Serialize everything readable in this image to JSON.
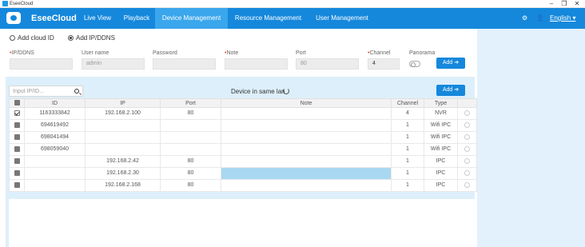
{
  "window": {
    "title": "EseeCloud",
    "minimize": "–",
    "maximize": "❐",
    "close": "✕"
  },
  "nav": {
    "logo": "EseeCloud",
    "items": [
      "Live View",
      "Playback",
      "Device Management",
      "Resource Management",
      "User Management"
    ],
    "active": "Device Management",
    "language": "English ▾"
  },
  "add_mode": {
    "cloud_id_label": "Add cloud ID",
    "ip_ddns_label": "Add IP/DDNS",
    "selected": "Add IP/DDNS"
  },
  "form": {
    "ip_ddns_label": "IP/DDNS",
    "username_label": "User name",
    "username_value": "admin",
    "password_label": "Password",
    "note_label": "Note",
    "port_label": "Port",
    "port_value": "80",
    "channel_label": "Channel",
    "channel_value": "4",
    "panorama_label": "Panorama",
    "add_button": "Add ➔",
    "required_mark": "•"
  },
  "lan": {
    "search_placeholder": "Input IP/ID...",
    "title": "Device in same lan",
    "add_button": "Add ➔"
  },
  "table": {
    "columns": [
      "ID",
      "IP",
      "Port",
      "Note",
      "Channel",
      "Type"
    ],
    "rows": [
      {
        "checked": true,
        "id": "1163333842",
        "ip": "192.168.2.100",
        "port": "80",
        "note": "",
        "channel": "4",
        "type": "NVR"
      },
      {
        "checked": false,
        "id": "694619492",
        "ip": "",
        "port": "",
        "note": "",
        "channel": "1",
        "type": "Wifi IPC"
      },
      {
        "checked": false,
        "id": "698041494",
        "ip": "",
        "port": "",
        "note": "",
        "channel": "1",
        "type": "Wifi IPC"
      },
      {
        "checked": false,
        "id": "698059040",
        "ip": "",
        "port": "",
        "note": "",
        "channel": "1",
        "type": "Wifi IPC"
      },
      {
        "checked": false,
        "id": "",
        "ip": "192.168.2.42",
        "port": "80",
        "note": "",
        "channel": "1",
        "type": "IPC"
      },
      {
        "checked": false,
        "id": "",
        "ip": "192.168.2.30",
        "port": "80",
        "note": "",
        "channel": "1",
        "type": "IPC"
      },
      {
        "checked": false,
        "id": "",
        "ip": "192.168.2.168",
        "port": "80",
        "note": "",
        "channel": "1",
        "type": "IPC"
      }
    ]
  },
  "colors": {
    "brand": "#1588dc",
    "nav_active": "#3aa6ec",
    "panel": "#ddeffa",
    "selected_cell": "#a9d8f2"
  }
}
